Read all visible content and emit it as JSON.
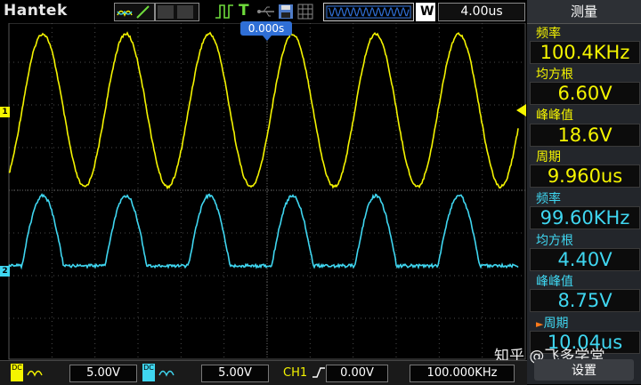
{
  "topbar": {
    "brand": "Hantek",
    "run_state": "T",
    "timebase_mode": "W",
    "timebase": "4.00us",
    "trigger_position": "0.000s"
  },
  "panel": {
    "title": "测量",
    "measurements": [
      {
        "label": "频率",
        "value": "100.4KHz",
        "channel": "ch1"
      },
      {
        "label": "均方根",
        "value": "6.60V",
        "channel": "ch1"
      },
      {
        "label": "峰峰值",
        "value": "18.6V",
        "channel": "ch1"
      },
      {
        "label": "周期",
        "value": "9.960us",
        "channel": "ch1"
      },
      {
        "label": "频率",
        "value": "99.60KHz",
        "channel": "ch2"
      },
      {
        "label": "均方根",
        "value": "4.40V",
        "channel": "ch2"
      },
      {
        "label": "峰峰值",
        "value": "8.75V",
        "channel": "ch2"
      },
      {
        "label": "周期",
        "value": "10.04us",
        "channel": "ch2"
      }
    ],
    "softkey": "设置"
  },
  "channels": {
    "ch1": {
      "marker": "1",
      "coupling": "DC",
      "volts_div": "5.00V",
      "color": "#f4f400"
    },
    "ch2": {
      "marker": "2",
      "coupling": "DC",
      "volts_div": "5.00V",
      "color": "#3fd6f0"
    }
  },
  "trigger": {
    "source": "CH1",
    "level": "0.00V",
    "frequency": "100.000KHz"
  },
  "watermark": "知乎 @飞多学堂",
  "colors": {
    "grid": "#4a4a4a",
    "panel": "#23262b",
    "accent": "#2f6fd6"
  }
}
